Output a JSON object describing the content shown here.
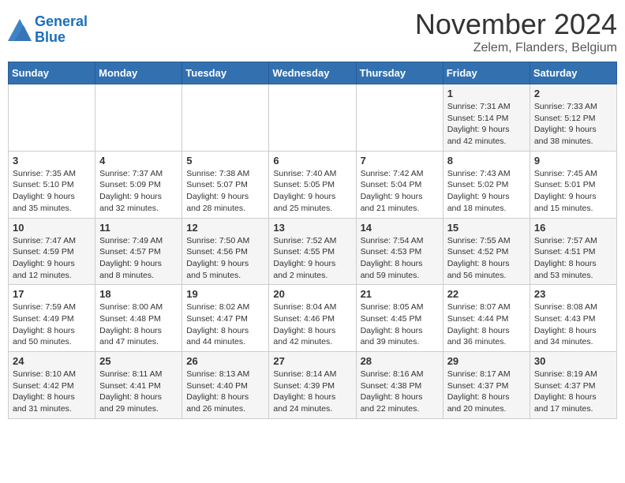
{
  "logo": {
    "line1": "General",
    "line2": "Blue"
  },
  "title": "November 2024",
  "location": "Zelem, Flanders, Belgium",
  "days_of_week": [
    "Sunday",
    "Monday",
    "Tuesday",
    "Wednesday",
    "Thursday",
    "Friday",
    "Saturday"
  ],
  "weeks": [
    [
      {
        "day": "",
        "info": ""
      },
      {
        "day": "",
        "info": ""
      },
      {
        "day": "",
        "info": ""
      },
      {
        "day": "",
        "info": ""
      },
      {
        "day": "",
        "info": ""
      },
      {
        "day": "1",
        "info": "Sunrise: 7:31 AM\nSunset: 5:14 PM\nDaylight: 9 hours and 42 minutes."
      },
      {
        "day": "2",
        "info": "Sunrise: 7:33 AM\nSunset: 5:12 PM\nDaylight: 9 hours and 38 minutes."
      }
    ],
    [
      {
        "day": "3",
        "info": "Sunrise: 7:35 AM\nSunset: 5:10 PM\nDaylight: 9 hours and 35 minutes."
      },
      {
        "day": "4",
        "info": "Sunrise: 7:37 AM\nSunset: 5:09 PM\nDaylight: 9 hours and 32 minutes."
      },
      {
        "day": "5",
        "info": "Sunrise: 7:38 AM\nSunset: 5:07 PM\nDaylight: 9 hours and 28 minutes."
      },
      {
        "day": "6",
        "info": "Sunrise: 7:40 AM\nSunset: 5:05 PM\nDaylight: 9 hours and 25 minutes."
      },
      {
        "day": "7",
        "info": "Sunrise: 7:42 AM\nSunset: 5:04 PM\nDaylight: 9 hours and 21 minutes."
      },
      {
        "day": "8",
        "info": "Sunrise: 7:43 AM\nSunset: 5:02 PM\nDaylight: 9 hours and 18 minutes."
      },
      {
        "day": "9",
        "info": "Sunrise: 7:45 AM\nSunset: 5:01 PM\nDaylight: 9 hours and 15 minutes."
      }
    ],
    [
      {
        "day": "10",
        "info": "Sunrise: 7:47 AM\nSunset: 4:59 PM\nDaylight: 9 hours and 12 minutes."
      },
      {
        "day": "11",
        "info": "Sunrise: 7:49 AM\nSunset: 4:57 PM\nDaylight: 9 hours and 8 minutes."
      },
      {
        "day": "12",
        "info": "Sunrise: 7:50 AM\nSunset: 4:56 PM\nDaylight: 9 hours and 5 minutes."
      },
      {
        "day": "13",
        "info": "Sunrise: 7:52 AM\nSunset: 4:55 PM\nDaylight: 9 hours and 2 minutes."
      },
      {
        "day": "14",
        "info": "Sunrise: 7:54 AM\nSunset: 4:53 PM\nDaylight: 8 hours and 59 minutes."
      },
      {
        "day": "15",
        "info": "Sunrise: 7:55 AM\nSunset: 4:52 PM\nDaylight: 8 hours and 56 minutes."
      },
      {
        "day": "16",
        "info": "Sunrise: 7:57 AM\nSunset: 4:51 PM\nDaylight: 8 hours and 53 minutes."
      }
    ],
    [
      {
        "day": "17",
        "info": "Sunrise: 7:59 AM\nSunset: 4:49 PM\nDaylight: 8 hours and 50 minutes."
      },
      {
        "day": "18",
        "info": "Sunrise: 8:00 AM\nSunset: 4:48 PM\nDaylight: 8 hours and 47 minutes."
      },
      {
        "day": "19",
        "info": "Sunrise: 8:02 AM\nSunset: 4:47 PM\nDaylight: 8 hours and 44 minutes."
      },
      {
        "day": "20",
        "info": "Sunrise: 8:04 AM\nSunset: 4:46 PM\nDaylight: 8 hours and 42 minutes."
      },
      {
        "day": "21",
        "info": "Sunrise: 8:05 AM\nSunset: 4:45 PM\nDaylight: 8 hours and 39 minutes."
      },
      {
        "day": "22",
        "info": "Sunrise: 8:07 AM\nSunset: 4:44 PM\nDaylight: 8 hours and 36 minutes."
      },
      {
        "day": "23",
        "info": "Sunrise: 8:08 AM\nSunset: 4:43 PM\nDaylight: 8 hours and 34 minutes."
      }
    ],
    [
      {
        "day": "24",
        "info": "Sunrise: 8:10 AM\nSunset: 4:42 PM\nDaylight: 8 hours and 31 minutes."
      },
      {
        "day": "25",
        "info": "Sunrise: 8:11 AM\nSunset: 4:41 PM\nDaylight: 8 hours and 29 minutes."
      },
      {
        "day": "26",
        "info": "Sunrise: 8:13 AM\nSunset: 4:40 PM\nDaylight: 8 hours and 26 minutes."
      },
      {
        "day": "27",
        "info": "Sunrise: 8:14 AM\nSunset: 4:39 PM\nDaylight: 8 hours and 24 minutes."
      },
      {
        "day": "28",
        "info": "Sunrise: 8:16 AM\nSunset: 4:38 PM\nDaylight: 8 hours and 22 minutes."
      },
      {
        "day": "29",
        "info": "Sunrise: 8:17 AM\nSunset: 4:37 PM\nDaylight: 8 hours and 20 minutes."
      },
      {
        "day": "30",
        "info": "Sunrise: 8:19 AM\nSunset: 4:37 PM\nDaylight: 8 hours and 17 minutes."
      }
    ]
  ],
  "colors": {
    "header_bg": "#3370b0",
    "header_text": "#ffffff",
    "odd_row": "#f5f5f5",
    "even_row": "#ffffff"
  }
}
